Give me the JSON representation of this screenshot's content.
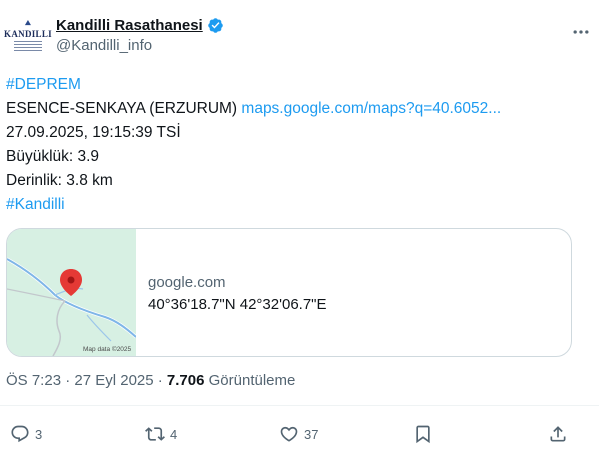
{
  "user": {
    "display_name": "Kandilli Rasathanesi",
    "handle": "@Kandilli_info",
    "avatar_text_top": "KANDILLI",
    "avatar_text_main": "KANDILLI"
  },
  "tweet": {
    "hashtag_1": "#DEPREM",
    "location": "ESENCE-SENKAYA (ERZURUM)",
    "link": "maps.google.com/maps?q=40.6052...",
    "datetime": "27.09.2025, 19:15:39 TSİ",
    "magnitude": "Büyüklük: 3.9",
    "depth": "Derinlik: 3.8 km",
    "hashtag_2": "#Kandilli"
  },
  "card": {
    "domain": "google.com",
    "coords": "40°36'18.7\"N 42°32'06.7\"E",
    "map_credit": "Map data ©2025"
  },
  "meta": {
    "time": "ÖS 7:23 · 27 Eyl 2025 · ",
    "views_count": "7.706",
    "views_label": " Görüntüleme"
  },
  "actions": {
    "reply_count": "3",
    "retweet_count": "4",
    "like_count": "37"
  },
  "colors": {
    "accent": "#1d9bf0",
    "secondary_text": "#536471",
    "map_bg": "#d7f0e3",
    "river": "#7fb6e8",
    "pin": "#e53935"
  }
}
